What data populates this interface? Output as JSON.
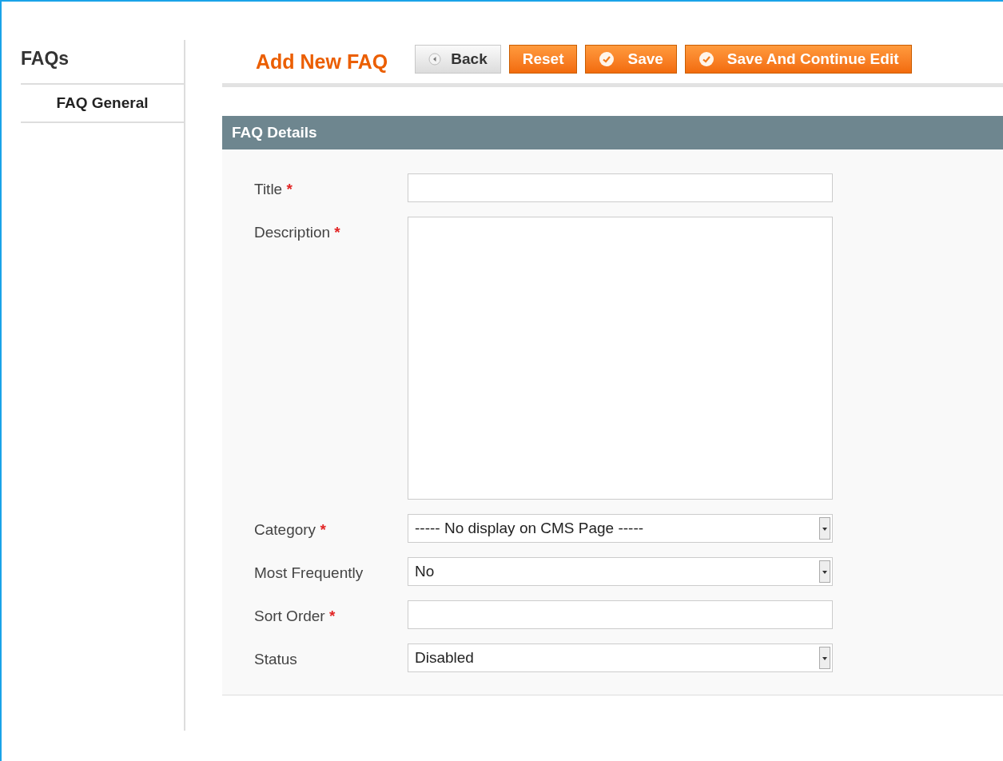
{
  "sidebar": {
    "title": "FAQs",
    "items": [
      {
        "label": "FAQ General",
        "selected": true
      }
    ]
  },
  "header": {
    "title": "Add New FAQ",
    "buttons": [
      {
        "label": "Back",
        "kind": "back"
      },
      {
        "label": "Reset",
        "kind": "plain"
      },
      {
        "label": "Save",
        "kind": "check"
      },
      {
        "label": "Save And Continue Edit",
        "kind": "check"
      }
    ]
  },
  "panel": {
    "title": "FAQ Details",
    "fields": [
      {
        "label": "Title",
        "required_mark": "*",
        "kind": "text"
      },
      {
        "label": "Description",
        "required_mark": "*",
        "kind": "textarea"
      },
      {
        "label": "Category",
        "required_mark": "*",
        "kind": "select",
        "value": "----- No display on CMS Page -----"
      },
      {
        "label": "Most Frequently",
        "kind": "select",
        "value": "No"
      },
      {
        "label": "Sort Order",
        "required_mark": "*",
        "kind": "text"
      },
      {
        "label": "Status",
        "kind": "select",
        "value": "Disabled"
      }
    ]
  }
}
